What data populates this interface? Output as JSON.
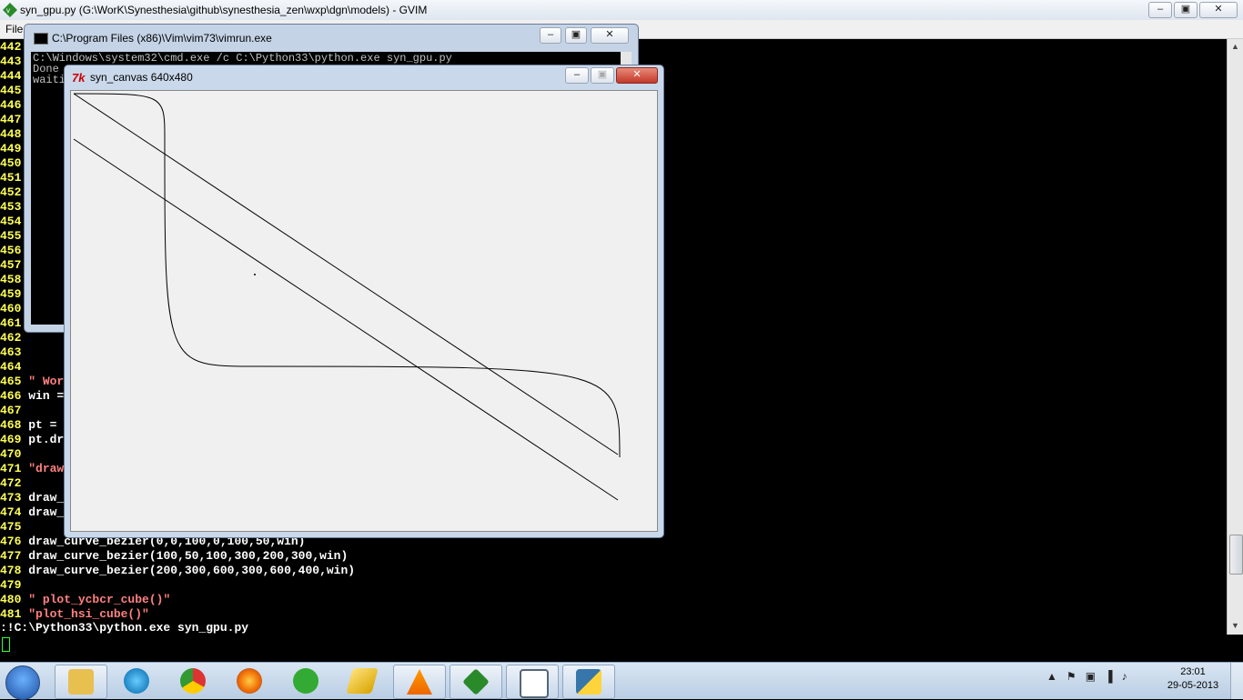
{
  "gvim": {
    "title": "syn_gpu.py (G:\\WorK\\Synesthesia\\github\\synesthesia_zen\\wxp\\dgn\\models) - GVIM",
    "menu_first": "File",
    "cmdline": ":!C:\\Python33\\python.exe syn_gpu.py"
  },
  "lines": [
    {
      "n": "442",
      "t": ""
    },
    {
      "n": "443",
      "t": ""
    },
    {
      "n": "444",
      "t": ""
    },
    {
      "n": "445",
      "t": ""
    },
    {
      "n": "446",
      "t": ""
    },
    {
      "n": "447",
      "t": ""
    },
    {
      "n": "448",
      "t": ""
    },
    {
      "n": "449",
      "t": ""
    },
    {
      "n": "450",
      "t": ""
    },
    {
      "n": "451",
      "t": ""
    },
    {
      "n": "452",
      "t": ""
    },
    {
      "n": "453",
      "t": ""
    },
    {
      "n": "454",
      "t": ""
    },
    {
      "n": "455",
      "t": ""
    },
    {
      "n": "456",
      "t": ""
    },
    {
      "n": "457",
      "t": ""
    },
    {
      "n": "458",
      "t": ""
    },
    {
      "n": "459",
      "t": ""
    },
    {
      "n": "460",
      "t": ""
    },
    {
      "n": "461",
      "t": ""
    },
    {
      "n": "462",
      "t": ""
    },
    {
      "n": "463",
      "t": ""
    },
    {
      "n": "464",
      "t": ""
    },
    {
      "n": "465",
      "t": "\" Wor",
      "c": "s"
    },
    {
      "n": "466",
      "t": "win =",
      "c": "w"
    },
    {
      "n": "467",
      "t": ""
    },
    {
      "n": "468",
      "t": "pt =",
      "c": "w"
    },
    {
      "n": "469",
      "t": "pt.dr",
      "c": "w"
    },
    {
      "n": "470",
      "t": ""
    },
    {
      "n": "471",
      "t": "\"draw",
      "c": "s"
    },
    {
      "n": "472",
      "t": ""
    },
    {
      "n": "473",
      "t": "draw_",
      "c": "w"
    },
    {
      "n": "474",
      "t": "draw_",
      "c": "w"
    },
    {
      "n": "475",
      "t": ""
    },
    {
      "n": "476",
      "t": "draw_curve_bezier(0,0,100,0,100,50,win)",
      "c": "w"
    },
    {
      "n": "477",
      "t": "draw_curve_bezier(100,50,100,300,200,300,win)",
      "c": "w"
    },
    {
      "n": "478",
      "t": "draw_curve_bezier(200,300,600,300,600,400,win)",
      "c": "w"
    },
    {
      "n": "479",
      "t": ""
    },
    {
      "n": "480",
      "t": "\" plot_ycbcr_cube()\"",
      "c": "s"
    },
    {
      "n": "481",
      "t": "\"plot_hsi_cube()\"",
      "c": "s"
    }
  ],
  "cmd_window": {
    "title": "C:\\Program Files (x86)\\Vim\\vim73\\vimrun.exe",
    "lines": [
      "C:\\Windows\\system32\\cmd.exe /c C:\\Python33\\python.exe syn_gpu.py",
      "Done",
      "waiti"
    ]
  },
  "canvas_window": {
    "title": "syn_canvas 640x480",
    "icon_text": "7k"
  },
  "taskbar": {
    "apps": [
      "file-explorer",
      "internet-explorer",
      "chrome",
      "firefox",
      "utorrent",
      "winamp",
      "vlc",
      "gvim",
      "notepad",
      "python"
    ],
    "clock_time": "23:01",
    "clock_date": "29-05-2013"
  },
  "colors": {
    "line_number": "#ffff55",
    "string": "#ff8080",
    "canvas_bg": "#f0f0f0"
  }
}
